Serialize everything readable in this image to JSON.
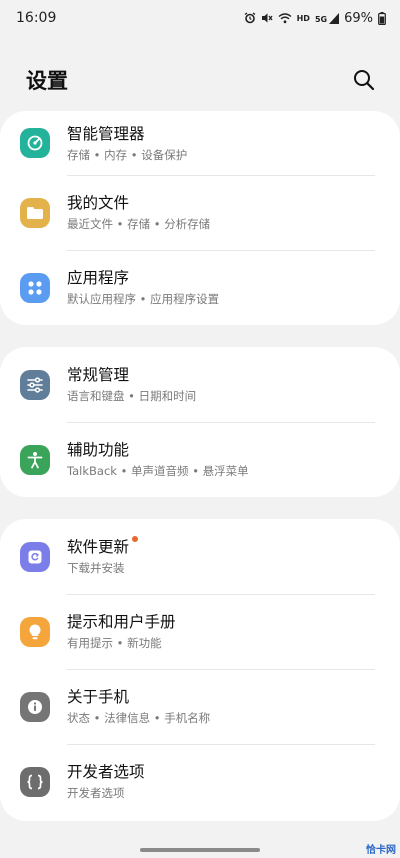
{
  "status": {
    "time": "16:09",
    "hd": "HD",
    "net": "5G",
    "battery": "69%"
  },
  "header": {
    "title": "设置",
    "search_icon": "search-icon"
  },
  "groups": [
    [
      {
        "name": "smart-manager",
        "title": "智能管理器",
        "subtitle": "存储 • 内存 • 设备保护",
        "icon": "device-care-icon",
        "color": "#23b39b"
      },
      {
        "name": "my-files",
        "title": "我的文件",
        "subtitle": "最近文件 • 存储 • 分析存储",
        "icon": "folder-icon",
        "color": "#e4b24a"
      },
      {
        "name": "apps",
        "title": "应用程序",
        "subtitle": "默认应用程序 • 应用程序设置",
        "icon": "apps-grid-icon",
        "color": "#5a9cf2"
      }
    ],
    [
      {
        "name": "general-management",
        "title": "常规管理",
        "subtitle": "语言和键盘 • 日期和时间",
        "icon": "sliders-icon",
        "color": "#607d99"
      },
      {
        "name": "accessibility",
        "title": "辅助功能",
        "subtitle": "TalkBack • 单声道音频 • 悬浮菜单",
        "icon": "accessibility-person-icon",
        "color": "#3aa55a"
      }
    ],
    [
      {
        "name": "software-update",
        "title": "软件更新",
        "subtitle": "下载并安装",
        "icon": "update-icon",
        "color": "#7b7ee8",
        "badge": true
      },
      {
        "name": "tips-manual",
        "title": "提示和用户手册",
        "subtitle": "有用提示 • 新功能",
        "icon": "lightbulb-icon",
        "color": "#f4a53b"
      },
      {
        "name": "about-phone",
        "title": "关于手机",
        "subtitle": "状态 • 法律信息 • 手机名称",
        "icon": "info-icon",
        "color": "#757575"
      },
      {
        "name": "developer-options",
        "title": "开发者选项",
        "subtitle": "开发者选项",
        "icon": "braces-icon",
        "color": "#6d6d6d"
      }
    ]
  ],
  "colors": {
    "background": "#f2f2f2",
    "card": "#ffffff",
    "badge": "#e8682e"
  },
  "watermark": "恰卡网"
}
